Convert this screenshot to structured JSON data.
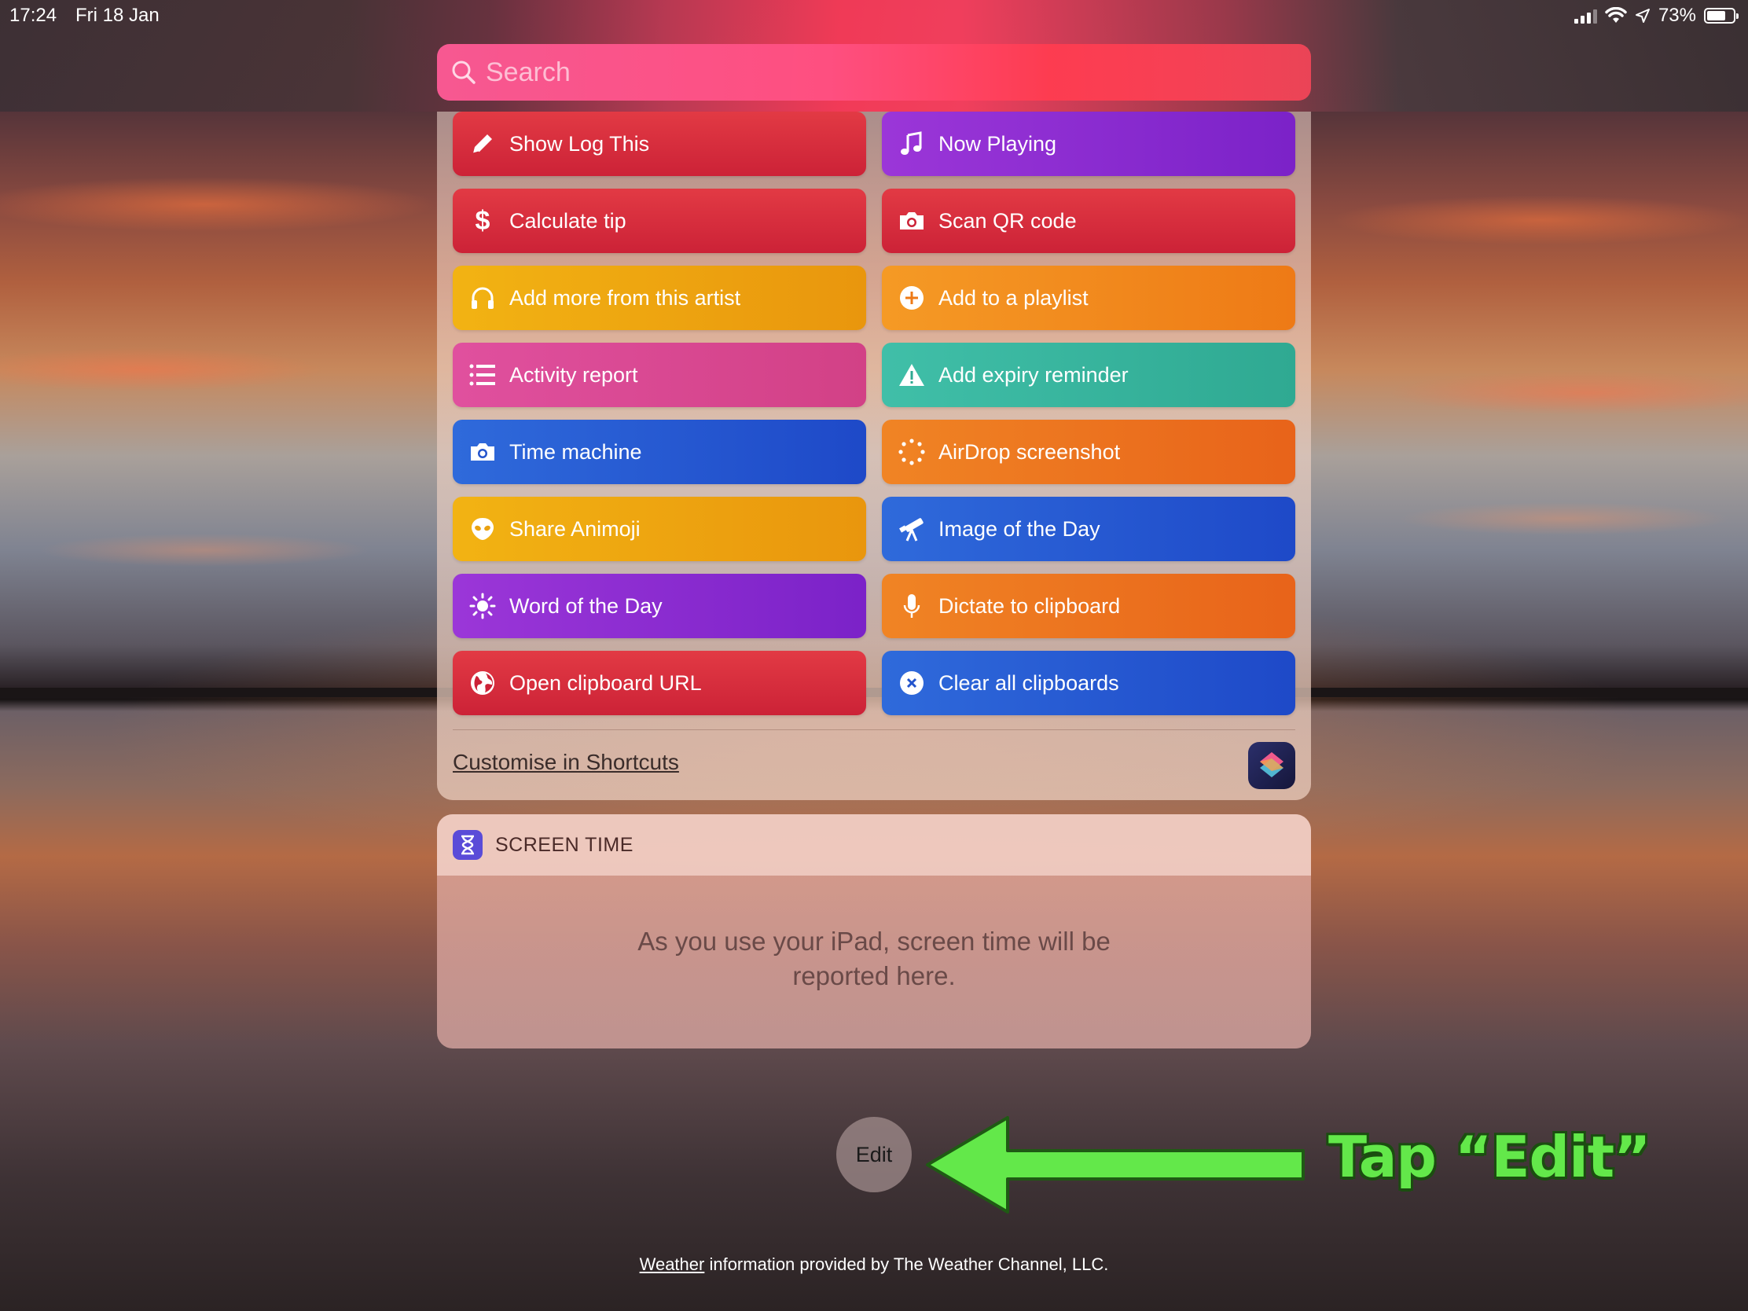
{
  "status_bar": {
    "time": "17:24",
    "date": "Fri 18 Jan",
    "battery": "73%"
  },
  "search": {
    "placeholder": "Search"
  },
  "shortcuts": [
    {
      "label": "Show Log This",
      "color": "red",
      "icon": "pencil-icon"
    },
    {
      "label": "Now Playing",
      "color": "purple",
      "icon": "music-note-icon"
    },
    {
      "label": "Calculate tip",
      "color": "red",
      "icon": "dollar-icon"
    },
    {
      "label": "Scan QR code",
      "color": "red",
      "icon": "camera-icon"
    },
    {
      "label": "Add more from this artist",
      "color": "yellow",
      "icon": "headphones-icon"
    },
    {
      "label": "Add to a playlist",
      "color": "orange",
      "icon": "plus-circle-icon"
    },
    {
      "label": "Activity report",
      "color": "pink",
      "icon": "list-icon"
    },
    {
      "label": "Add expiry reminder",
      "color": "teal",
      "icon": "warning-icon"
    },
    {
      "label": "Time machine",
      "color": "blue",
      "icon": "camera-icon"
    },
    {
      "label": "AirDrop screenshot",
      "color": "orange2",
      "icon": "airdrop-icon"
    },
    {
      "label": "Share Animoji",
      "color": "yellow",
      "icon": "alien-icon"
    },
    {
      "label": "Image of the Day",
      "color": "blue",
      "icon": "telescope-icon"
    },
    {
      "label": "Word of the Day",
      "color": "purple",
      "icon": "sun-icon"
    },
    {
      "label": "Dictate to clipboard",
      "color": "orange2",
      "icon": "microphone-icon"
    },
    {
      "label": "Open clipboard URL",
      "color": "red",
      "icon": "globe-icon"
    },
    {
      "label": "Clear all clipboards",
      "color": "blue",
      "icon": "x-circle-icon"
    }
  ],
  "customise_link": "Customise in Shortcuts",
  "screen_time": {
    "title": "SCREEN TIME",
    "message_line1": "As you use your iPad, screen time will be",
    "message_line2": "reported here."
  },
  "edit_button": "Edit",
  "annotation": "Tap “Edit”",
  "footer": {
    "link": "Weather",
    "text": " information provided by The Weather Channel, LLC."
  }
}
